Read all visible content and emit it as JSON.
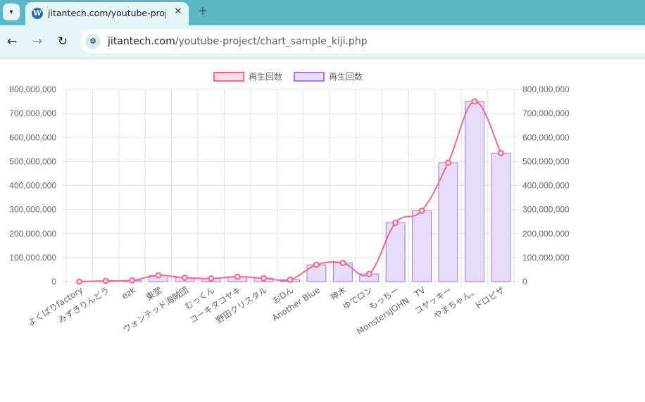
{
  "browser": {
    "tab_title": "jitantech.com/youtube-project/",
    "url_host": "jitantech.com",
    "url_path": "/youtube-project/chart_sample_kiji.php",
    "icons": {
      "tab_menu": "chevron-down-icon",
      "favicon": "wordpress-icon",
      "close": "close-icon",
      "new_tab": "plus-icon",
      "back": "arrow-left-icon",
      "forward": "arrow-right-icon",
      "reload": "reload-icon",
      "site_info": "tune-icon"
    }
  },
  "chart_data": {
    "type": "bar",
    "categories": [
      "よくばりfactory",
      "みずきりんどう",
      "ezk",
      "東堂",
      "ウォンテッド海賊団",
      "むっくん",
      "コーキタコヤキ",
      "野田クリスタル",
      "おDん",
      "Another Blue",
      "神木",
      "ゆでロン",
      "もっちー",
      "MonstersJOHN　TV",
      "コヤッキー",
      "やまちゃん。",
      "ドロピザ"
    ],
    "series": [
      {
        "name": "再生回数",
        "type": "line",
        "axis": "y-left",
        "values": [
          0,
          3000000,
          5000000,
          26000000,
          16000000,
          13000000,
          20000000,
          14000000,
          8000000,
          70000000,
          78000000,
          32000000,
          245000000,
          295000000,
          495000000,
          750000000,
          535000000
        ],
        "color": "#f06a8c",
        "fill": "#ffdde3"
      },
      {
        "name": "再生回数",
        "type": "bar",
        "axis": "y-right",
        "values": [
          0,
          3000000,
          5000000,
          26000000,
          16000000,
          13000000,
          20000000,
          14000000,
          8000000,
          70000000,
          78000000,
          32000000,
          245000000,
          295000000,
          495000000,
          750000000,
          535000000
        ],
        "color": "#a57be0",
        "fill": "#e8dcfb"
      }
    ],
    "y_left": {
      "ticks": [
        "0",
        "100,000,000",
        "200,000,000",
        "300,000,000",
        "400,000,000",
        "500,000,000",
        "600,000,000",
        "700,000,000",
        "800,000,000"
      ],
      "ylim": [
        0,
        800000000
      ]
    },
    "y_right": {
      "ticks": [
        "0",
        "100,000,000",
        "200,000,000",
        "300,000,000",
        "400,000,000",
        "500,000,000",
        "600,000,000",
        "700,000,000",
        "800,000,000"
      ],
      "ylim": [
        0,
        800000000
      ]
    },
    "legend": "top-center",
    "grid": true,
    "xlabel": "",
    "ylabel": ""
  }
}
